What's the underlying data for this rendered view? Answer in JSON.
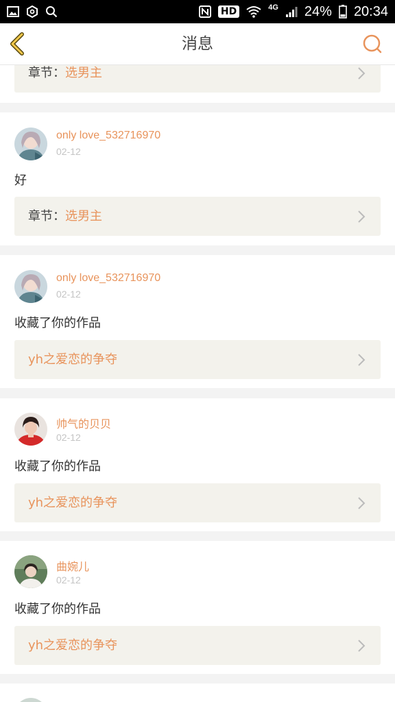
{
  "status_bar": {
    "network": "4G",
    "battery": "24%",
    "time": "20:34",
    "hd": "HD",
    "left_icons": [
      "image-icon",
      "gear-hex-icon",
      "search-icon"
    ],
    "right_icons": [
      "nfc-icon",
      "hd-icon",
      "wifi-icon",
      "signal-icon",
      "battery-icon"
    ]
  },
  "header": {
    "title": "消息",
    "back_icon": "chevron-left-icon",
    "search_icon": "search-icon"
  },
  "colors": {
    "accent": "#e8935b",
    "back_icon_yellow": "#f2c94c",
    "link_bg": "#f3f2ec"
  },
  "messages": [
    {
      "link_prefix": "章节：",
      "link_label": "选男主"
    },
    {
      "username": "only love_532716970",
      "date": "02-12",
      "text": "好",
      "link_prefix": "章节：",
      "link_label": "选男主"
    },
    {
      "username": "only love_532716970",
      "date": "02-12",
      "text": "收藏了你的作品",
      "link_prefix": "",
      "link_label": "yh之爱恋的争夺"
    },
    {
      "username": "帅气的贝贝",
      "date": "02-12",
      "text": "收藏了你的作品",
      "link_prefix": "",
      "link_label": "yh之爱恋的争夺"
    },
    {
      "username": "曲婉儿",
      "date": "02-12",
      "text": "收藏了你的作品",
      "link_prefix": "",
      "link_label": "yh之爱恋的争夺"
    }
  ]
}
